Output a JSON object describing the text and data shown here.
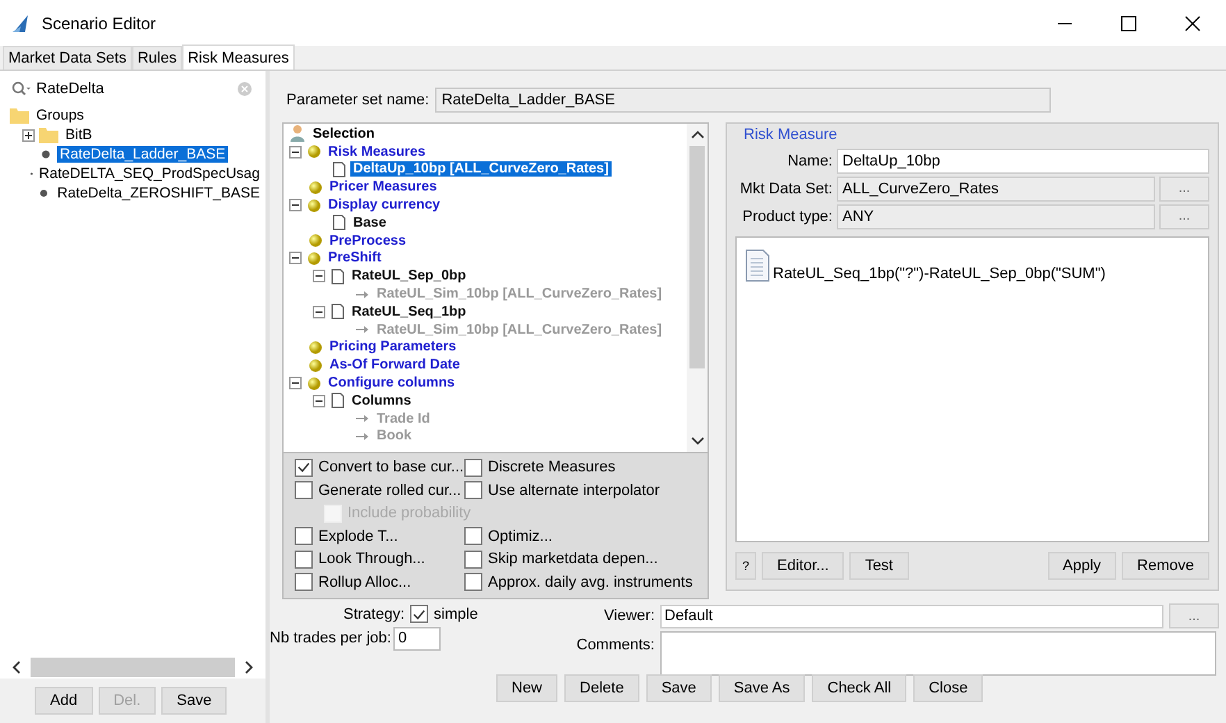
{
  "window": {
    "title": "Scenario Editor"
  },
  "tabs": [
    {
      "label": "Market Data Sets",
      "selected": false
    },
    {
      "label": "Rules",
      "selected": false
    },
    {
      "label": "Risk Measures",
      "selected": true
    }
  ],
  "search": {
    "value": "RateDelta"
  },
  "groups_tree": [
    {
      "label": "Groups",
      "kind": "folder",
      "selected": false,
      "children": [
        {
          "label": "BitB",
          "kind": "folder",
          "expanded": false,
          "selected": false
        },
        {
          "label": "RateDelta_Ladder_BASE",
          "kind": "item",
          "selected": true
        },
        {
          "label": "RateDELTA_SEQ_ProdSpecUsag",
          "kind": "item",
          "selected": false
        },
        {
          "label": "RateDelta_ZEROSHIFT_BASE",
          "kind": "item",
          "selected": false
        }
      ]
    }
  ],
  "left_buttons": [
    {
      "label": "Add",
      "disabled": false
    },
    {
      "label": "Del.",
      "disabled": true
    },
    {
      "label": "Save",
      "disabled": false
    }
  ],
  "parameter_set": {
    "label": "Parameter set name:",
    "value": "RateDelta_Ladder_BASE"
  },
  "selection_tree": [
    {
      "label": "Selection",
      "kind": "root",
      "selected": false,
      "children": [
        {
          "label": "Risk Measures",
          "kind": "section",
          "expanded": true,
          "selected": false,
          "children": [
            {
              "label": "DeltaUp_10bp [ALL_CurveZero_Rates]",
              "kind": "doc",
              "selected": true
            }
          ]
        },
        {
          "label": "Pricer Measures",
          "kind": "section",
          "selected": false
        },
        {
          "label": "Display currency",
          "kind": "section",
          "expanded": true,
          "selected": false,
          "children": [
            {
              "label": "Base",
              "kind": "doc",
              "selected": false
            }
          ]
        },
        {
          "label": "PreProcess",
          "kind": "section",
          "selected": false
        },
        {
          "label": "PreShift",
          "kind": "section",
          "expanded": true,
          "selected": false,
          "children": [
            {
              "label": "RateUL_Sep_0bp",
              "kind": "doc",
              "expanded": true,
              "selected": false,
              "children": [
                {
                  "label": "RateUL_Sim_10bp [ALL_CurveZero_Rates]",
                  "kind": "ref",
                  "selected": false
                }
              ]
            },
            {
              "label": "RateUL_Seq_1bp",
              "kind": "doc",
              "expanded": true,
              "selected": false,
              "children": [
                {
                  "label": "RateUL_Sim_10bp [ALL_CurveZero_Rates]",
                  "kind": "ref",
                  "selected": false
                }
              ]
            }
          ]
        },
        {
          "label": "Pricing Parameters",
          "kind": "section",
          "selected": false
        },
        {
          "label": "As-Of Forward Date",
          "kind": "section",
          "selected": false
        },
        {
          "label": "Configure columns",
          "kind": "section",
          "expanded": true,
          "selected": false,
          "children": [
            {
              "label": "Columns",
              "kind": "doc",
              "expanded": true,
              "selected": false,
              "children": [
                {
                  "label": "Trade Id",
                  "kind": "ref",
                  "selected": false
                },
                {
                  "label": "Book",
                  "kind": "ref",
                  "selected": false
                }
              ]
            }
          ]
        }
      ]
    }
  ],
  "options": [
    [
      {
        "label": "Convert to base cur...",
        "checked": true,
        "disabled": false
      },
      {
        "label": "Discrete Measures",
        "checked": false,
        "disabled": false
      }
    ],
    [
      {
        "label": "Generate rolled cur...",
        "checked": false,
        "disabled": false
      },
      {
        "label": "Use alternate interpolator",
        "checked": false,
        "disabled": false
      }
    ],
    [
      {
        "label": "Include probability",
        "checked": false,
        "disabled": true
      }
    ],
    [
      {
        "label": "Explode T...",
        "checked": false,
        "disabled": false
      },
      {
        "label": "Optimiz...",
        "checked": false,
        "disabled": false
      }
    ],
    [
      {
        "label": "Look Through...",
        "checked": false,
        "disabled": false
      },
      {
        "label": "Skip marketdata depen...",
        "checked": false,
        "disabled": false
      }
    ],
    [
      {
        "label": "Rollup Alloc...",
        "checked": false,
        "disabled": false
      },
      {
        "label": "Approx. daily avg. instruments",
        "checked": false,
        "disabled": false
      }
    ]
  ],
  "strategy": {
    "label": "Strategy:",
    "checked": true,
    "option": "simple"
  },
  "nb_trades": {
    "label": "Nb trades per job:",
    "value": "0"
  },
  "risk_measure": {
    "title": "Risk Measure",
    "fields": [
      {
        "label": "Name:",
        "value": "DeltaUp_10bp",
        "readonly": false
      },
      {
        "label": "Mkt Data Set:",
        "value": "ALL_CurveZero_Rates",
        "readonly": true,
        "button": "..."
      },
      {
        "label": "Product type:",
        "value": "ANY",
        "readonly": true,
        "button": "..."
      }
    ],
    "formula": "RateUL_Seq_1bp(\"?\")-RateUL_Sep_0bp(\"SUM\")",
    "left_buttons": [
      "?",
      "Editor...",
      "Test"
    ],
    "right_buttons": [
      "Apply",
      "Remove"
    ]
  },
  "viewer": {
    "label": "Viewer:",
    "value": "Default",
    "button": "..."
  },
  "comments": {
    "label": "Comments:"
  },
  "bottom_buttons": [
    "New",
    "Delete",
    "Save",
    "Save As",
    "Check All",
    "Close"
  ]
}
